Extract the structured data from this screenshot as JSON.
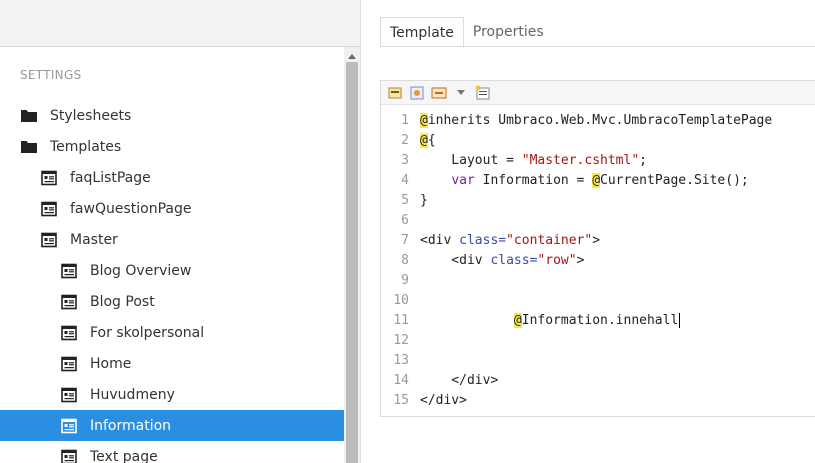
{
  "tree": {
    "section_title": "SETTINGS",
    "items": [
      {
        "label": "Stylesheets",
        "type": "folder",
        "indent": 0
      },
      {
        "label": "Templates",
        "type": "folder",
        "indent": 0
      },
      {
        "label": "faqListPage",
        "type": "template",
        "indent": 1
      },
      {
        "label": "fawQuestionPage",
        "type": "template",
        "indent": 1
      },
      {
        "label": "Master",
        "type": "template",
        "indent": 1
      },
      {
        "label": "Blog Overview",
        "type": "template",
        "indent": 2
      },
      {
        "label": "Blog Post",
        "type": "template",
        "indent": 2
      },
      {
        "label": "For skolpersonal",
        "type": "template",
        "indent": 2
      },
      {
        "label": "Home",
        "type": "template",
        "indent": 2
      },
      {
        "label": "Huvudmeny",
        "type": "template",
        "indent": 2
      },
      {
        "label": "Information",
        "type": "template",
        "indent": 2,
        "selected": true
      },
      {
        "label": "Text page",
        "type": "template",
        "indent": 2
      }
    ]
  },
  "tabs": [
    {
      "label": "Template",
      "active": true
    },
    {
      "label": "Properties",
      "active": false
    }
  ],
  "editor": {
    "line_numbers": [
      "1",
      "2",
      "3",
      "4",
      "5",
      "6",
      "7",
      "8",
      "9",
      "10",
      "11",
      "12",
      "13",
      "14",
      "15"
    ],
    "lines": {
      "l1": "inherits Umbraco.Web.Mvc.UmbracoTemplatePage",
      "l2": "{",
      "l3a": "    Layout = ",
      "l3b": "\"Master.cshtml\"",
      "l3c": ";",
      "l4a": "    ",
      "l4b": "var",
      "l4c": " Information = ",
      "l4d": "CurrentPage.Site();",
      "l5": "}",
      "l7a": "<div ",
      "l7b": "class=",
      "l7c": "\"container\"",
      "l7d": ">",
      "l8a": "    <div ",
      "l8b": "class=",
      "l8c": "\"row\"",
      "l8d": ">",
      "l11a": "            ",
      "l11b": "Information.innehall",
      "l14": "    </div>",
      "l15": "</div>",
      "at": "@"
    }
  },
  "colors": {
    "selected_bg": "#2a8fe3",
    "razor_highlight": "#f5e84a",
    "string": "#a31515",
    "keyword": "#7a1fa2"
  }
}
